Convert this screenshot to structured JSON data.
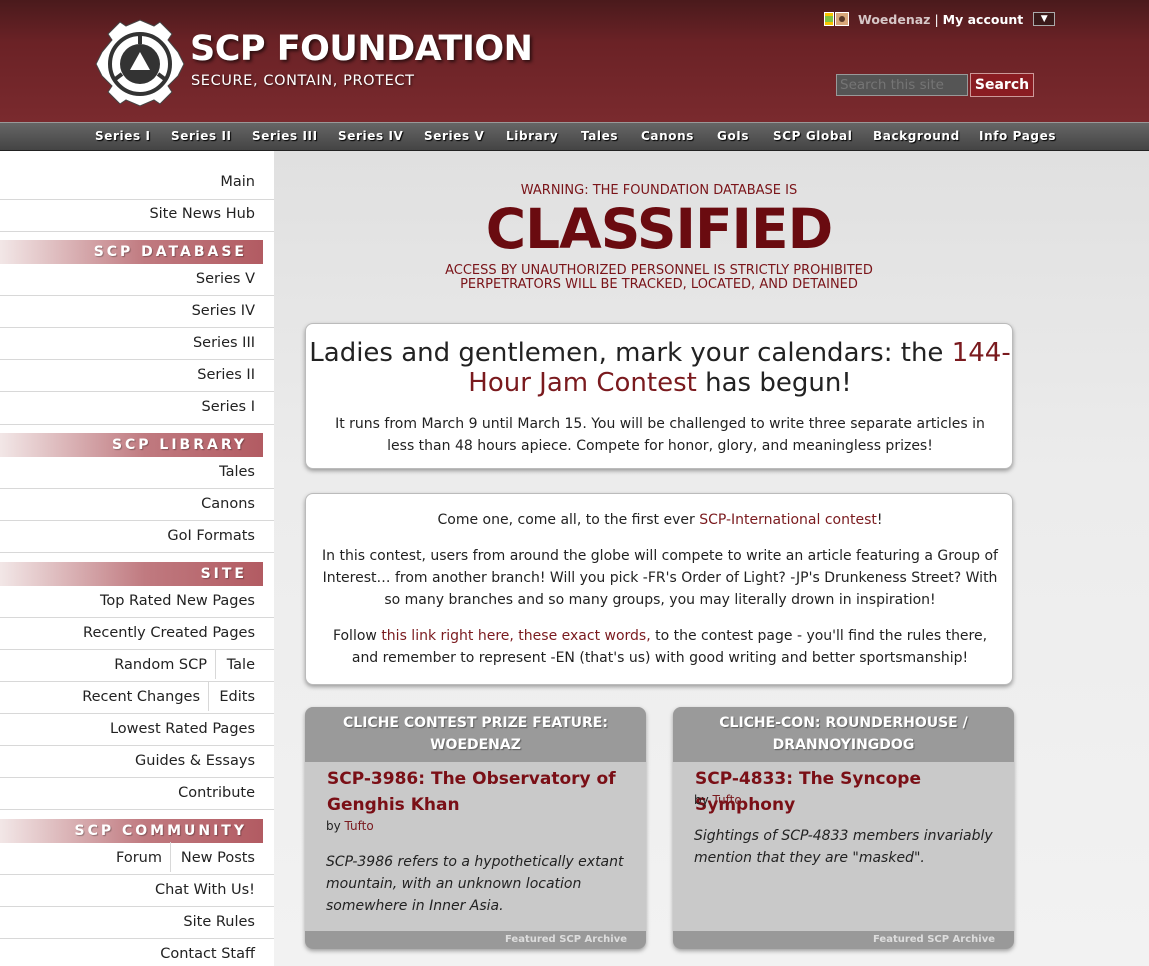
{
  "header": {
    "title": "SCP FOUNDATION",
    "subtitle": "SECURE, CONTAIN, PROTECT",
    "logo_icon": "scp-logo-icon",
    "username": "Woedenaz",
    "separator": "|",
    "my_account": "My account",
    "dropdown_glyph": "▼",
    "search_placeholder": "Search this site",
    "search_button": "Search"
  },
  "nav": {
    "items": [
      "Series I",
      "Series II",
      "Series III",
      "Series IV",
      "Series V",
      "Library",
      "Tales",
      "Canons",
      "GoIs",
      "SCP Global",
      "Background",
      "Info Pages"
    ]
  },
  "sidebar": {
    "main": "Main",
    "news_hub": "Site News Hub",
    "db_header": "SCP DATABASE",
    "series": [
      "Series V",
      "Series IV",
      "Series III",
      "Series II",
      "Series I"
    ],
    "library_header": "SCP LIBRARY",
    "library": [
      "Tales",
      "Canons",
      "GoI Formats"
    ],
    "site_header": "SITE",
    "top_rated_new": "Top Rated New Pages",
    "recently_created": "Recently Created Pages",
    "random_scp": "Random SCP",
    "tale": "Tale",
    "recent_changes": "Recent Changes",
    "edits": "Edits",
    "lowest_rated": "Lowest Rated Pages",
    "guides": "Guides & Essays",
    "contribute": "Contribute",
    "community_header": "SCP COMMUNITY",
    "forum": "Forum",
    "new_posts": "New Posts",
    "chat": "Chat With Us!",
    "rules": "Site Rules",
    "contact": "Contact Staff"
  },
  "warning": {
    "top": "WARNING: THE FOUNDATION DATABASE IS",
    "big": "CLASSIFIED",
    "line1": "ACCESS BY UNAUTHORIZED PERSONNEL IS STRICTLY PROHIBITED",
    "line2": "PERPETRATORS WILL BE TRACKED, LOCATED, AND DETAINED"
  },
  "jam": {
    "headline_a": "Ladies and gentlemen, mark your calendars: the ",
    "headline_link": "144-Hour Jam Contest",
    "headline_b": " has begun!",
    "body": "It runs from March 9 until March 15. You will be challenged to write three separate articles in less than 48 hours apiece. Compete for honor, glory, and meaningless prizes!"
  },
  "intl": {
    "p1_a": "Come one, come all, to the first ever ",
    "p1_link": "SCP-International contest",
    "p1_b": "!",
    "p2": "In this contest, users from around the globe will compete to write an article featuring a Group of Interest… from another branch! Will you pick -FR's Order of Light? -JP's Drunkeness Street? With so many branches and so many groups, you may literally drown in inspiration!",
    "p3_a": "Follow ",
    "p3_link": "this link right here, these exact words,",
    "p3_b": " to the contest page - you'll find the rules there, and remember to represent -EN (that's us) with good writing and better sportsmanship!"
  },
  "features": [
    {
      "header": "CLICHE CONTEST PRIZE FEATURE: WOEDENAZ",
      "title": "SCP-3986: The Observatory of Genghis Khan",
      "by": "by ",
      "author": "Tufto",
      "desc": "SCP-3986 refers to a hypothetically extant mountain, with an unknown location somewhere in Inner Asia.",
      "footer": "Featured SCP Archive"
    },
    {
      "header": "CLICHE-CON: ROUNDERHOUSE / DRANNOYINGDOG",
      "title": "SCP-4833: The Syncope Symphony",
      "by": "by ",
      "author": "Tufto",
      "desc": "Sightings of SCP-4833 members invariably mention that they are \"masked\".",
      "footer": "Featured SCP Archive"
    }
  ]
}
